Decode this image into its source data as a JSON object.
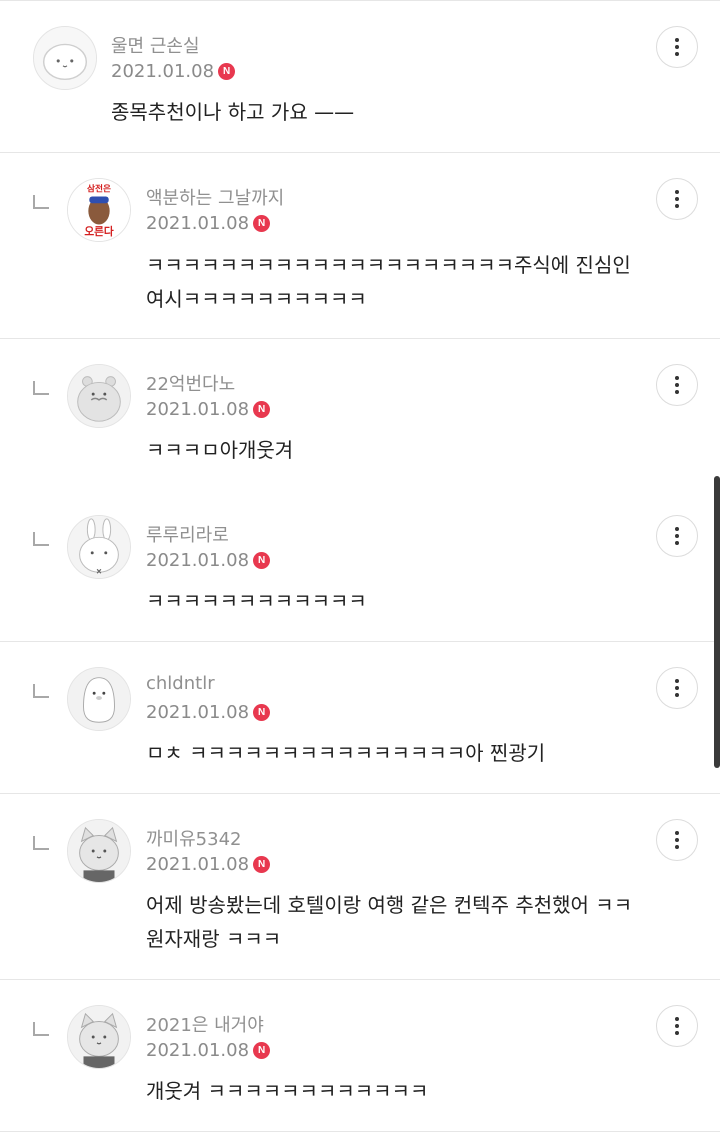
{
  "comments": [
    {
      "nickname": "울면 근손실",
      "date": "2021.01.08",
      "badge": "N",
      "body": "종목추천이나 하고 가요 ——",
      "reply": false
    },
    {
      "nickname": "액분하는 그날까지",
      "date": "2021.01.08",
      "badge": "N",
      "body": "ㅋㅋㅋㅋㅋㅋㅋㅋㅋㅋㅋㅋㅋㅋㅋㅋㅋㅋㅋㅋ주식에 진심인\n여시ㅋㅋㅋㅋㅋㅋㅋㅋㅋㅋ",
      "reply": true,
      "avatar_text_top": "삼전은",
      "avatar_text_bottom": "오른다"
    },
    {
      "nickname": "22억번다노",
      "date": "2021.01.08",
      "badge": "N",
      "body": "ㅋㅋㅋㅁ아개웃겨",
      "reply": true
    },
    {
      "nickname": "루루리라로",
      "date": "2021.01.08",
      "badge": "N",
      "body": "ㅋㅋㅋㅋㅋㅋㅋㅋㅋㅋㅋㅋ",
      "reply": true
    },
    {
      "nickname": "chldntlr",
      "date": "2021.01.08",
      "badge": "N",
      "body": "ㅁㅊ ㅋㅋㅋㅋㅋㅋㅋㅋㅋㅋㅋㅋㅋㅋㅋ아 찐광기",
      "reply": true
    },
    {
      "nickname": "까미유5342",
      "date": "2021.01.08",
      "badge": "N",
      "body": "어제 방송봤는데 호텔이랑 여행 같은 컨텍주 추천했어 ㅋㅋ\n원자재랑 ㅋㅋㅋ",
      "reply": true
    },
    {
      "nickname": "2021은 내거야",
      "date": "2021.01.08",
      "badge": "N",
      "body": "개웃겨 ㅋㅋㅋㅋㅋㅋㅋㅋㅋㅋㅋㅋ",
      "reply": true
    }
  ],
  "icons": {
    "more": "more-vertical-icon",
    "reply": "reply-arrow-icon",
    "new": "new-badge-icon"
  },
  "colors": {
    "badge": "#e8384f",
    "nickname": "#909090",
    "body": "#222222",
    "divider": "#e6e6e6"
  }
}
